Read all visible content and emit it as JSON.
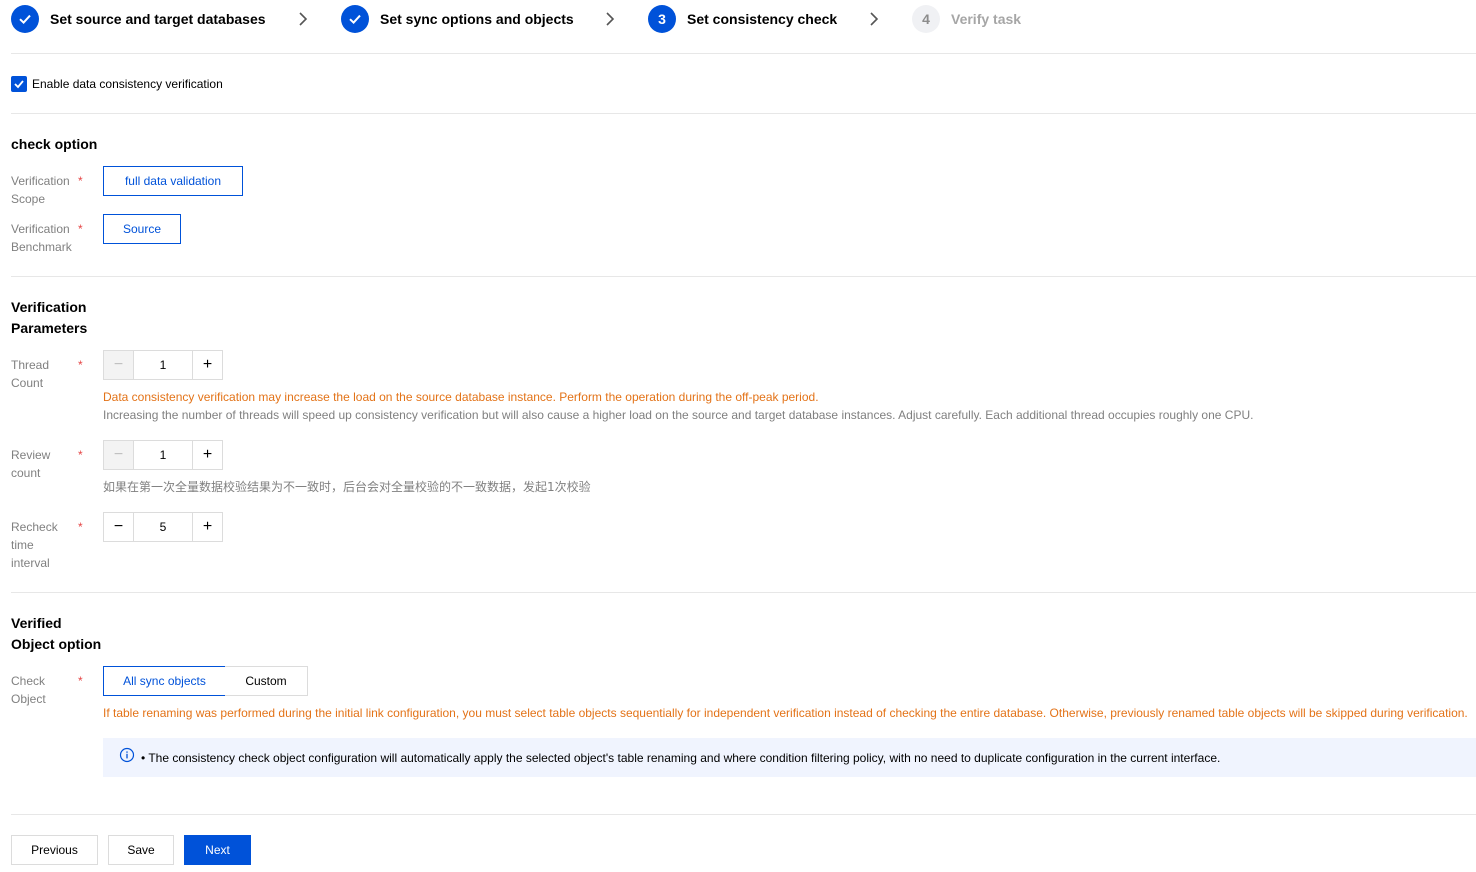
{
  "steps": [
    {
      "index": "1",
      "label": "Set source and target databases",
      "state": "done"
    },
    {
      "index": "2",
      "label": "Set sync options and objects",
      "state": "done"
    },
    {
      "index": "3",
      "label": "Set consistency check",
      "state": "current"
    },
    {
      "index": "4",
      "label": "Verify task",
      "state": "pending"
    }
  ],
  "enable": {
    "label": "Enable data consistency verification",
    "checked": true
  },
  "check_option": {
    "title": "check option",
    "scope": {
      "label_line1": "Verification",
      "label_line2": "Scope",
      "value": "full data validation"
    },
    "benchmark": {
      "label_line1": "Verification",
      "label_line2": "Benchmark",
      "value": "Source"
    }
  },
  "params": {
    "title_line1": "Verification",
    "title_line2": "Parameters",
    "thread": {
      "label_line1": "Thread",
      "label_line2": "Count",
      "value": "1",
      "warning": "Data consistency verification may increase the load on the source database instance. Perform the operation during the off-peak period.",
      "hint": "Increasing the number of threads will speed up consistency verification but will also cause a higher load on the source and target database instances. Adjust carefully. Each additional thread occupies roughly one CPU."
    },
    "review": {
      "label_line1": "Review",
      "label_line2": "count",
      "value": "1",
      "hint": "如果在第一次全量数据校验结果为不一致时，后台会对全量校验的不一致数据，发起1次校验"
    },
    "recheck": {
      "label_line1": "Recheck",
      "label_line2": "time",
      "label_line3": "interval",
      "value": "5"
    }
  },
  "objects": {
    "title_line1": "Verified",
    "title_line2": "Object option",
    "check": {
      "label_line1": "Check",
      "label_line2": "Object",
      "options": [
        "All sync objects",
        "Custom"
      ],
      "selected": "All sync objects"
    },
    "warning": "If table renaming was performed during the initial link configuration, you must select table objects sequentially for independent verification instead of checking the entire database. Otherwise, previously renamed table objects will be skipped during verification.",
    "info": "• The consistency check object configuration will automatically apply the selected object's table renaming and where condition filtering policy, with no need to duplicate configuration in the current interface."
  },
  "footer": {
    "previous": "Previous",
    "save": "Save",
    "next": "Next"
  },
  "required_mark": "*",
  "colors": {
    "primary": "#0052d9",
    "warning": "#e37318",
    "required": "#e54545",
    "info_bg": "#f0f4fe"
  }
}
